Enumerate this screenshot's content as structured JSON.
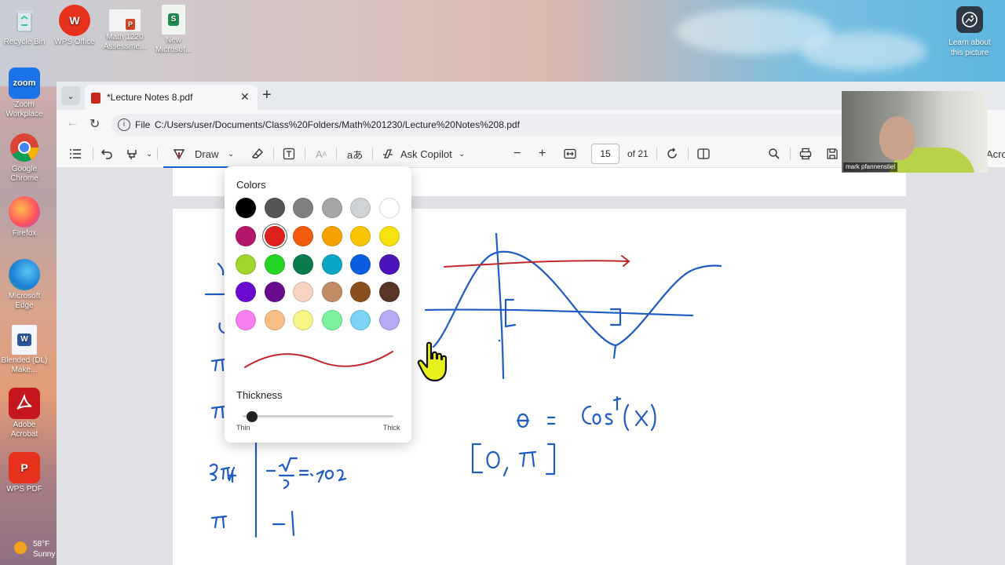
{
  "desktop": {
    "icons": [
      {
        "label": "Recycle Bin"
      },
      {
        "label": "WPS Office"
      },
      {
        "label": "Math 1220 Assessme..."
      },
      {
        "label": "New Microsof..."
      },
      {
        "label": "Zoom Workplace",
        "text": "zoom"
      },
      {
        "label": "Google Chrome"
      },
      {
        "label": "Firefox"
      },
      {
        "label": "Microsoft Edge"
      },
      {
        "label": "Blended (DL) Make..."
      },
      {
        "label": "Adobe Acrobat"
      },
      {
        "label": "WPS PDF"
      }
    ],
    "learn_about": "Learn about this picture",
    "weather": {
      "temp": "58°F",
      "condition": "Sunny"
    }
  },
  "browser": {
    "tab_title": "*Lecture Notes 8.pdf",
    "new_tab": "+",
    "tab_close": "✕",
    "address": {
      "scheme": "File",
      "url": "C:/Users/user/Documents/Class%20Folders/Math%201230/Lecture%20Notes%208.pdf"
    }
  },
  "pdf_toolbar": {
    "draw_label": "Draw",
    "ask_copilot": "Ask Copilot",
    "page_current": "15",
    "page_total": "of 21",
    "text_label_icon": "aあ",
    "partial_right": "Acro"
  },
  "color_popup": {
    "heading": "Colors",
    "thickness_heading": "Thickness",
    "thin_label": "Thin",
    "thick_label": "Thick",
    "thickness_value": 0.05,
    "selected_color": "#e0201c",
    "preview_color": "#c0262a",
    "rows": [
      [
        "#000000",
        "#555555",
        "#808080",
        "#a6a6a6",
        "#d0d3d6",
        "#ffffff"
      ],
      [
        "#b4166a",
        "#e0201c",
        "#f25c0c",
        "#f7a200",
        "#f7c600",
        "#f5e30b"
      ],
      [
        "#9fd72c",
        "#23d623",
        "#0a7b4a",
        "#0aa7c4",
        "#0a5ee0",
        "#4a12b8"
      ],
      [
        "#6a0ad0",
        "#6a0a8e",
        "#f7d3c2",
        "#c18c63",
        "#8a4f1e",
        "#5a3628"
      ],
      [
        "#f77ef0",
        "#f9bd86",
        "#f7f486",
        "#7cf29a",
        "#7cd3f7",
        "#b9aaf5"
      ]
    ]
  },
  "webcam": {
    "name": "mark pfannenstiel"
  },
  "colors": {
    "ink_blue": "#1f5bc6",
    "ink_red": "#c0262a",
    "accent": "#1a5fd0"
  },
  "notes": {
    "equation": "θ = Cos⁻¹(x)",
    "interval": "[0, π]",
    "table_rows": [
      "3π/4  −√2/2 = −.707",
      "π  −1"
    ]
  }
}
